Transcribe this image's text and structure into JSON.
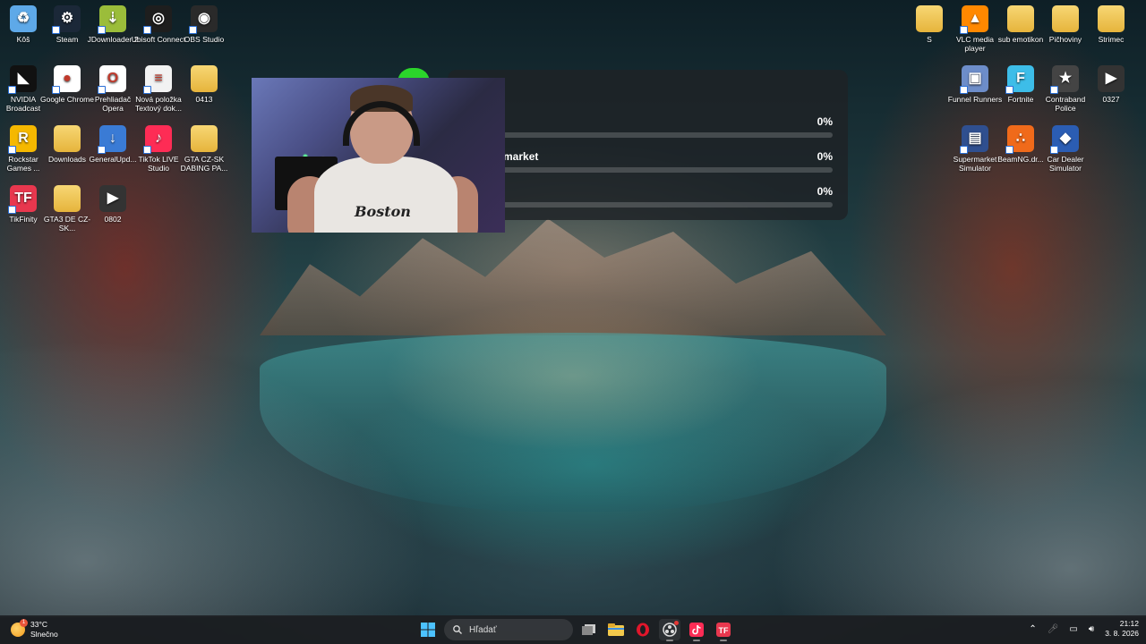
{
  "desktop_left": [
    {
      "label": "Kôš",
      "icon": "recycle-bin-icon",
      "color": "#5ea9e8"
    },
    {
      "label": "Steam",
      "icon": "steam-icon",
      "color": "#1b2838"
    },
    {
      "label": "JDownloader 2",
      "icon": "jdownloader-icon",
      "color": "#9bbd3a"
    },
    {
      "label": "Ubisoft Connect",
      "icon": "ubisoft-icon",
      "color": "#1e1e1e"
    },
    {
      "label": "OBS Studio",
      "icon": "obs-icon",
      "color": "#2a2a2a"
    },
    {
      "label": "NVIDIA Broadcast",
      "icon": "nvidia-icon",
      "color": "#111111"
    },
    {
      "label": "Google Chrome",
      "icon": "chrome-icon",
      "color": "#ffffff"
    },
    {
      "label": "Prehliadač Opera",
      "icon": "opera-icon",
      "color": "#ffffff"
    },
    {
      "label": "Nová položka Textový dok...",
      "icon": "text-document-icon",
      "color": "#f2f2f2"
    },
    {
      "label": "0413",
      "icon": "folder-icon",
      "color": "#e6b43c"
    },
    {
      "label": "Rockstar Games ...",
      "icon": "rockstar-icon",
      "color": "#f5b800"
    },
    {
      "label": "Downloads",
      "icon": "folder-icon",
      "color": "#e6b43c"
    },
    {
      "label": "GeneralUpd...",
      "icon": "installer-icon",
      "color": "#3a7bd5"
    },
    {
      "label": "TikTok LIVE Studio",
      "icon": "tiktok-icon",
      "color": "#fe2c55"
    },
    {
      "label": "GTA CZ-SK DABING PA...",
      "icon": "folder-icon",
      "color": "#e6b43c"
    },
    {
      "label": "TikFinity",
      "icon": "tikfinity-icon",
      "color": "#e8374e"
    },
    {
      "label": "GTA3 DE CZ-SK...",
      "icon": "folder-icon",
      "color": "#e6b43c"
    },
    {
      "label": "0802",
      "icon": "video-file-icon",
      "color": "#333333"
    }
  ],
  "desktop_right": [
    {
      "label": "S",
      "icon": "folder-icon",
      "color": "#e6b43c"
    },
    {
      "label": "VLC media player",
      "icon": "vlc-icon",
      "color": "#ff8800"
    },
    {
      "label": "sub emotikon",
      "icon": "folder-icon",
      "color": "#e6b43c"
    },
    {
      "label": "Pičhoviny",
      "icon": "folder-icon",
      "color": "#e6b43c"
    },
    {
      "label": "Strimec",
      "icon": "folder-icon",
      "color": "#e6b43c"
    },
    {
      "label": "Funnel Runners",
      "icon": "funnel-runners-icon",
      "color": "#6d8dc9"
    },
    {
      "label": "Fortnite",
      "icon": "fortnite-icon",
      "color": "#3dbde8"
    },
    {
      "label": "Contraband Police",
      "icon": "contraband-police-icon",
      "color": "#444444"
    },
    {
      "label": "0327",
      "icon": "video-file-icon",
      "color": "#333333"
    },
    {
      "label": "Supermarket Simulator",
      "icon": "supermarket-icon",
      "color": "#2f4f8f"
    },
    {
      "label": "BeamNG.dr...",
      "icon": "beamng-icon",
      "color": "#f06a1a"
    },
    {
      "label": "Car Dealer Simulator",
      "icon": "car-dealer-icon",
      "color": "#2b5db3"
    }
  ],
  "progress_panel": {
    "rows": [
      {
        "name": "",
        "percent_label": "0%",
        "progress": 0
      },
      {
        "name": "market",
        "percent_label": "0%",
        "progress": 0
      },
      {
        "name": "",
        "percent_label": "0%",
        "progress": 0
      }
    ]
  },
  "webcam": {
    "shirt_text": "Boston"
  },
  "taskbar": {
    "weather": {
      "temperature": "33°C",
      "condition": "Slnečno",
      "badge": "1"
    },
    "search_placeholder": "Hľadať",
    "apps": [
      "start-icon",
      "task-view-icon",
      "file-explorer-icon",
      "opera-icon",
      "obs-icon",
      "tiktok-icon",
      "tikfinity-icon"
    ],
    "clock": {
      "time": "21:12",
      "date": "3. 8. 2026"
    }
  }
}
